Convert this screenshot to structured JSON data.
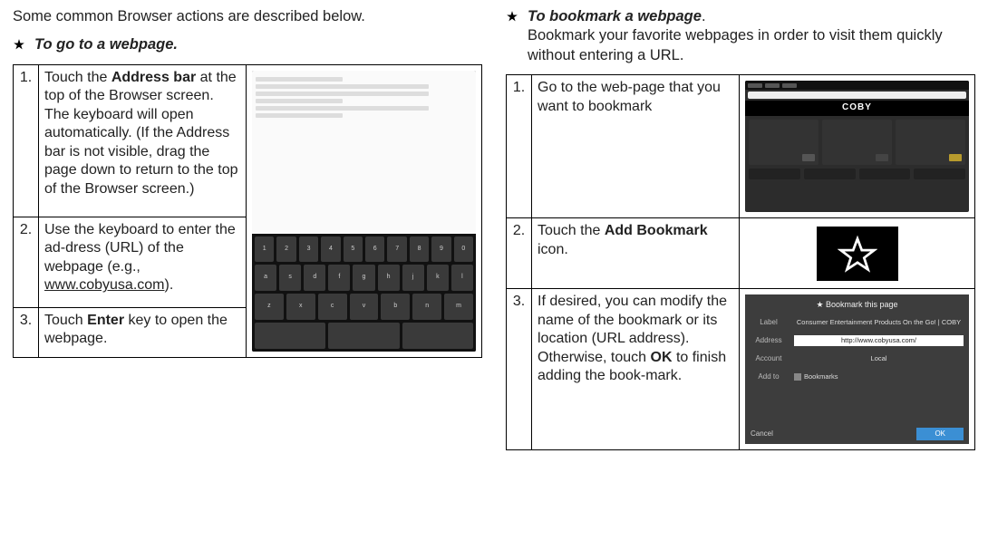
{
  "left": {
    "intro": "Some common Browser actions are described below.",
    "heading": "To go to a webpage.",
    "steps": [
      {
        "n": "1.",
        "pre": "Touch the ",
        "bold": "Address bar",
        "post": " at the top of the Browser screen. The keyboard will open automatically. (If the Address bar is not visible, drag the page down to return to the top of the Browser screen.)"
      },
      {
        "n": "2.",
        "pre": "Use the keyboard to enter the ad-dress (URL) of the webpage (e.g., ",
        "under": "www.cobyusa.com",
        "post": ")."
      },
      {
        "n": "3.",
        "pre": "Touch ",
        "bold": "Enter",
        "post": " key to open the webpage."
      }
    ]
  },
  "right": {
    "heading_bold": "To bookmark a webpage",
    "heading_tail": ".",
    "heading_desc": "Bookmark your favorite webpages in order to visit them quickly without entering a URL.",
    "step1": {
      "n": "1.",
      "text": "Go to the web-page that you want to bookmark"
    },
    "step2": {
      "n": "2.",
      "pre": "Touch the ",
      "bold": "Add Bookmark",
      "post": " icon."
    },
    "step3": {
      "n": "3.",
      "pre": "If desired, you can modify the name of the bookmark or its location (URL address). Otherwise, touch ",
      "bold": "OK",
      "post": " to finish adding the book-mark."
    },
    "dialog": {
      "title": "Bookmark this page",
      "label_lbl": "Label",
      "label_val": "Consumer Entertainment Products On the Go! | COBY",
      "addr_lbl": "Address",
      "addr_val": "http://www.cobyusa.com/",
      "account_lbl": "Account",
      "account_val": "Local",
      "addto_lbl": "Add to",
      "addto_val": "Bookmarks",
      "cancel": "Cancel",
      "ok": "OK"
    },
    "coby_brand": "COBY"
  }
}
